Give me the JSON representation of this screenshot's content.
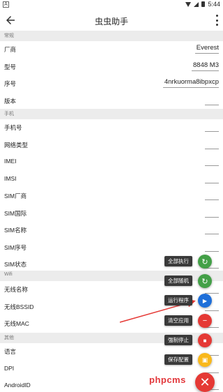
{
  "status_bar": {
    "time": "5:44",
    "left_icon": "A"
  },
  "app_bar": {
    "title": "虫虫助手"
  },
  "sections": [
    {
      "header": "常规",
      "rows": [
        {
          "label": "厂商",
          "value": "Everest"
        },
        {
          "label": "型号",
          "value": "8848 M3"
        },
        {
          "label": "序号",
          "value": "4nrkuorma8ibpxcp"
        },
        {
          "label": "版本",
          "value": ""
        }
      ]
    },
    {
      "header": "手机",
      "rows": [
        {
          "label": "手机号",
          "value": ""
        },
        {
          "label": "网络类型",
          "value": ""
        },
        {
          "label": "IMEI",
          "value": ""
        },
        {
          "label": "IMSI",
          "value": ""
        },
        {
          "label": "SIM厂商",
          "value": ""
        },
        {
          "label": "SIM国际",
          "value": ""
        },
        {
          "label": "SIM名称",
          "value": ""
        },
        {
          "label": "SIM序号",
          "value": ""
        },
        {
          "label": "SIM状态",
          "value": ""
        }
      ]
    },
    {
      "header": "Wifi",
      "rows": [
        {
          "label": "无线名称",
          "value": ""
        },
        {
          "label": "无线BSSID",
          "value": ""
        },
        {
          "label": "无线MAC",
          "value": ""
        }
      ]
    },
    {
      "header": "其他",
      "rows": [
        {
          "label": "语言",
          "value": ""
        },
        {
          "label": "DPI",
          "value": ""
        },
        {
          "label": "AndroidID",
          "value": ""
        }
      ]
    }
  ],
  "fab_menu": [
    {
      "label": "全部执行",
      "icon": "refresh-icon",
      "color": "#43a047"
    },
    {
      "label": "全部随机",
      "icon": "refresh-icon",
      "color": "#43a047"
    },
    {
      "label": "运行程序",
      "icon": "play-icon",
      "color": "#1e6fd9"
    },
    {
      "label": "清空应用",
      "icon": "minus-icon",
      "color": "#e53935"
    },
    {
      "label": "强制停止",
      "icon": "stop-icon",
      "color": "#e53935"
    },
    {
      "label": "保存配置",
      "icon": "save-icon",
      "color": "#f9b81b"
    }
  ],
  "fab_main": {
    "icon": "close-icon",
    "color": "#e53935"
  },
  "watermark": "phpcms",
  "colors": {
    "arrow": "#e53935",
    "section_bg": "#ececec"
  }
}
